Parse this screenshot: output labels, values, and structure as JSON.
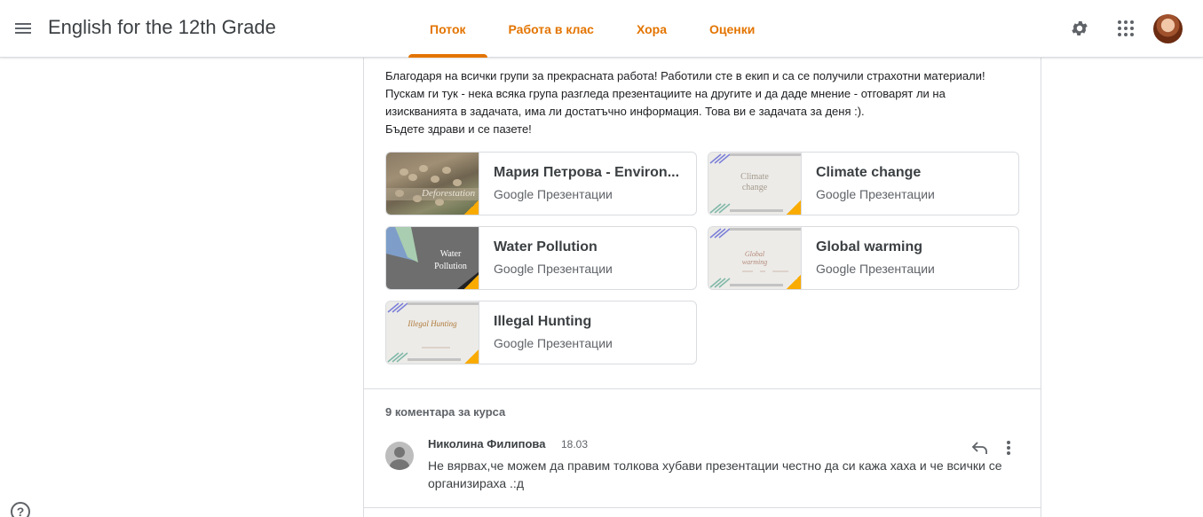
{
  "header": {
    "course_title": "English for the 12th Grade",
    "tabs": [
      {
        "label": "Поток",
        "active": true
      },
      {
        "label": "Работа в клас",
        "active": false
      },
      {
        "label": "Хора",
        "active": false
      },
      {
        "label": "Оценки",
        "active": false
      }
    ],
    "accent_color": "#e37400",
    "icons": [
      "menu-icon",
      "settings-icon",
      "apps-icon",
      "account-avatar"
    ]
  },
  "post": {
    "paragraphs": [
      "Благодаря на всички групи за прекрасната работа! Работили сте в екип и са се получили страхотни материали!",
      "Пускам ги тук - нека всяка група разгледа презентациите на другите и да даде мнение - отговарят ли на изискванията в задачата, има ли достатъчно информация. Това ви е задачата за деня :).",
      "Бъдете здрави и се пазете!"
    ],
    "attachments": [
      {
        "title": "Мария Петрова - Environ...",
        "type": "Google Презентации",
        "thumb_text": "Deforestation"
      },
      {
        "title": "Climate change",
        "type": "Google Презентации",
        "thumb_text": "Climate change"
      },
      {
        "title": "Water Pollution",
        "type": "Google Презентации",
        "thumb_text": "Water Pollution"
      },
      {
        "title": "Global warming",
        "type": "Google Презентации",
        "thumb_text": "Global warming"
      },
      {
        "title": "Illegal Hunting",
        "type": "Google Презентации",
        "thumb_text": "Illegal Hunting"
      }
    ]
  },
  "comments": {
    "count_label": "9 коментара за курса",
    "items": [
      {
        "author": "Николина Филипова",
        "date": "18.03",
        "text": "Не вярвах,че можем да правим толкова хубави презентации честно да си кажа хаха и че всички се организираха .:д"
      }
    ]
  },
  "help": {
    "symbol": "?"
  }
}
